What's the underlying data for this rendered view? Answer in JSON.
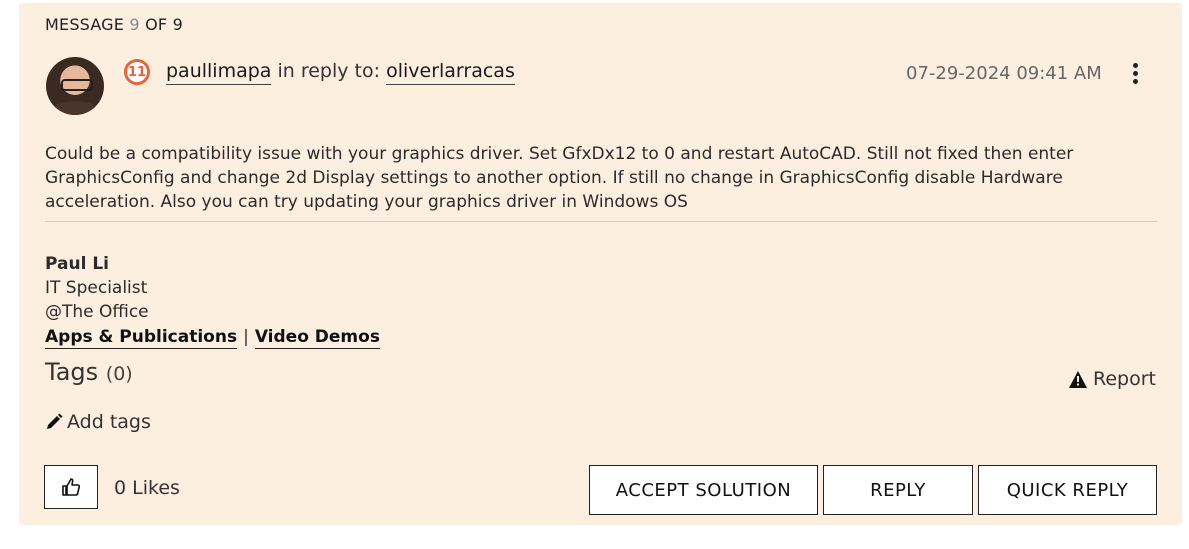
{
  "header": {
    "message_prefix": "MESSAGE",
    "message_index": "9",
    "message_suffix": "OF 9"
  },
  "post": {
    "author": "paullimapa",
    "reply_text": "in reply to:",
    "reply_to": "oliverlarracas",
    "rank_badge": "11",
    "timestamp": "07-29-2024 09:41 AM",
    "body": "Could be a compatibility issue with your graphics driver. Set GfxDx12 to 0 and restart AutoCAD. Still not fixed then enter GraphicsConfig and change 2d Display settings to another option. If still no change in GraphicsConfig disable Hardware acceleration. Also you can try updating your graphics driver in Windows OS"
  },
  "signature": {
    "name": "Paul Li",
    "title": "IT Specialist",
    "org": "@The Office",
    "link1": "Apps & Publications",
    "separator": "|",
    "link2": "Video Demos"
  },
  "tags": {
    "title": "Tags",
    "count": "(0)",
    "add_label": "Add tags"
  },
  "report_label": "Report",
  "likes_label": "0 Likes",
  "buttons": {
    "accept": "ACCEPT SOLUTION",
    "reply": "REPLY",
    "quick_reply": "QUICK REPLY"
  },
  "icons": {
    "kebab": "kebab-menu-icon",
    "warning": "warning-icon",
    "pencil": "pencil-icon",
    "thumbs_up": "thumbs-up-icon"
  },
  "colors": {
    "card_bg": "#fcefe0",
    "rank_accent": "#e8643c"
  }
}
